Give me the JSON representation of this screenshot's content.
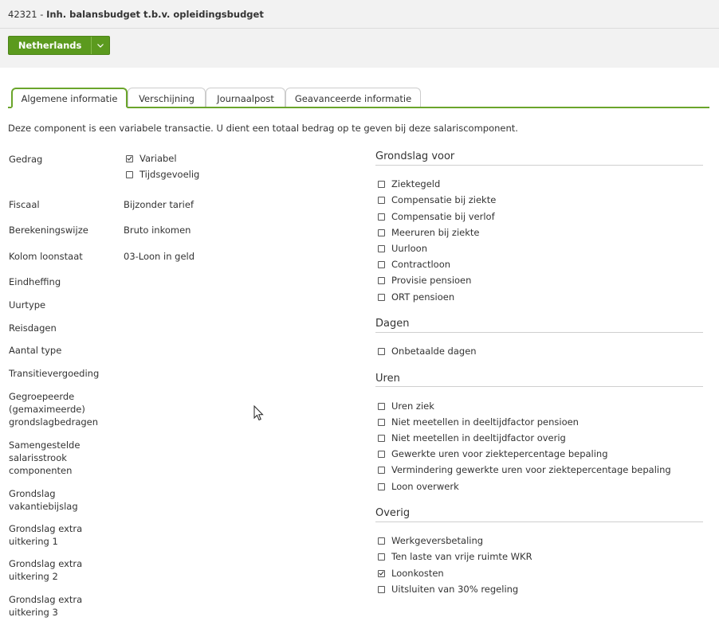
{
  "header": {
    "id": "42321",
    "separator": " - ",
    "name": "Inh. balansbudget t.b.v. opleidingsbudget",
    "country_button": "Netherlands",
    "country_caret_icon": "chevron-down-icon"
  },
  "colors": {
    "brand_green": "#5b9a1e",
    "tab_accent": "#6aa52b"
  },
  "tabs": [
    {
      "label": "Algemene informatie",
      "active": true
    },
    {
      "label": "Verschijning",
      "active": false
    },
    {
      "label": "Journaalpost",
      "active": false
    },
    {
      "label": "Geavanceerde informatie",
      "active": false
    }
  ],
  "intro": "Deze component is een variabele transactie. U dient een totaal bedrag op te geven bij deze salariscomponent.",
  "left": {
    "gedrag_label": "Gedrag",
    "gedrag_options": [
      {
        "label": "Variabel",
        "checked": true
      },
      {
        "label": "Tijdsgevoelig",
        "checked": false
      }
    ],
    "fields": [
      {
        "label": "Fiscaal",
        "value": "Bijzonder tarief"
      },
      {
        "label": "Berekeningswijze",
        "value": "Bruto inkomen"
      },
      {
        "label": "Kolom loonstaat",
        "value": "03-Loon in geld"
      },
      {
        "label": "Eindheffing",
        "value": ""
      },
      {
        "label": "Uurtype",
        "value": ""
      },
      {
        "label": "Reisdagen",
        "value": ""
      },
      {
        "label": "Aantal type",
        "value": ""
      },
      {
        "label": "Transitievergoeding",
        "value": ""
      },
      {
        "label": "Gegroepeerde (gemaximeerde) grondslagbedragen",
        "value": ""
      },
      {
        "label": "Samengestelde salarisstrook componenten",
        "value": ""
      },
      {
        "label": "Grondslag vakantiebijslag",
        "value": ""
      },
      {
        "label": "Grondslag extra uitkering 1",
        "value": ""
      },
      {
        "label": "Grondslag extra uitkering 2",
        "value": ""
      },
      {
        "label": "Grondslag extra uitkering 3",
        "value": ""
      }
    ]
  },
  "right": {
    "sections": [
      {
        "title": "Grondslag voor",
        "items": [
          {
            "label": "Ziektegeld",
            "checked": false
          },
          {
            "label": "Compensatie bij ziekte",
            "checked": false
          },
          {
            "label": "Compensatie bij verlof",
            "checked": false
          },
          {
            "label": "Meeruren bij ziekte",
            "checked": false
          },
          {
            "label": "Uurloon",
            "checked": false
          },
          {
            "label": "Contractloon",
            "checked": false
          },
          {
            "label": "Provisie pensioen",
            "checked": false
          },
          {
            "label": "ORT pensioen",
            "checked": false
          }
        ]
      },
      {
        "title": "Dagen",
        "items": [
          {
            "label": "Onbetaalde dagen",
            "checked": false
          }
        ]
      },
      {
        "title": "Uren",
        "items": [
          {
            "label": "Uren ziek",
            "checked": false
          },
          {
            "label": "Niet meetellen in deeltijdfactor pensioen",
            "checked": false
          },
          {
            "label": "Niet meetellen in deeltijdfactor overig",
            "checked": false
          },
          {
            "label": "Gewerkte uren voor ziektepercentage bepaling",
            "checked": false
          },
          {
            "label": "Vermindering gewerkte uren voor ziektepercentage bepaling",
            "checked": false
          },
          {
            "label": "Loon overwerk",
            "checked": false
          }
        ]
      },
      {
        "title": "Overig",
        "items": [
          {
            "label": "Werkgeversbetaling",
            "checked": false
          },
          {
            "label": "Ten laste van vrije ruimte WKR",
            "checked": false
          },
          {
            "label": "Loonkosten",
            "checked": true
          },
          {
            "label": "Uitsluiten van 30% regeling",
            "checked": false
          }
        ]
      }
    ]
  }
}
